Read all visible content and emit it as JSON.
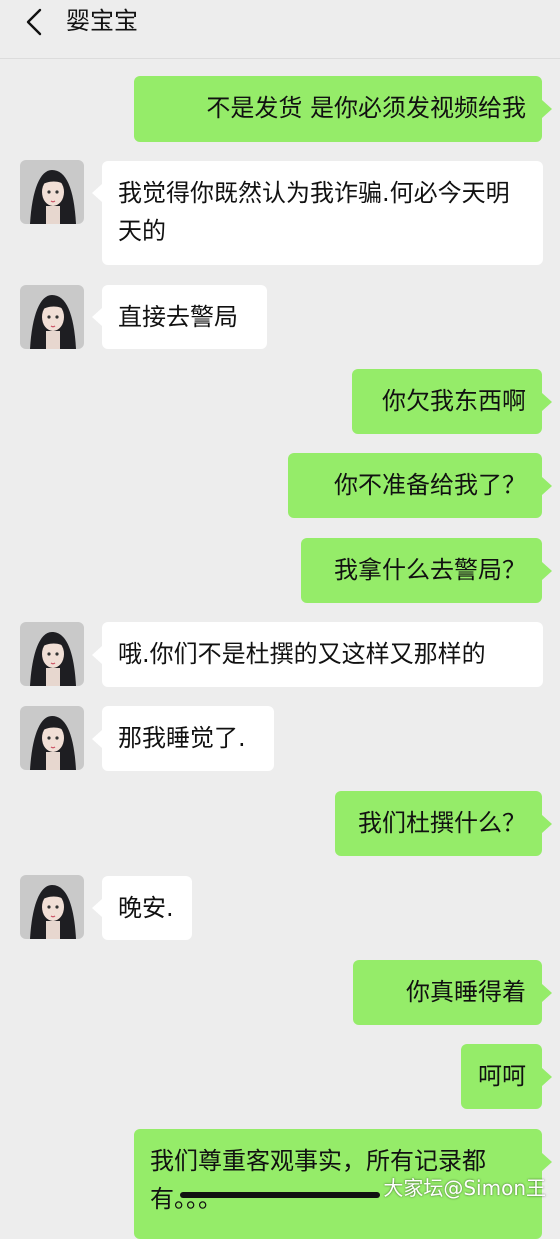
{
  "header": {
    "back_icon": "chevron-left-icon",
    "title": "婴宝宝"
  },
  "messages": [
    {
      "side": "sent",
      "text": "不是发货 是你必须发视频给我"
    },
    {
      "side": "recv",
      "text": "我觉得你既然认为我诈骗.何必今天明天的"
    },
    {
      "side": "recv",
      "text": "直接去警局"
    },
    {
      "side": "sent",
      "text": "你欠我东西啊"
    },
    {
      "side": "sent",
      "text": "你不准备给我了？"
    },
    {
      "side": "sent",
      "text": "我拿什么去警局？"
    },
    {
      "side": "recv",
      "text": "哦.你们不是杜撰的又这样又那样的"
    },
    {
      "side": "recv",
      "text": "那我睡觉了."
    },
    {
      "side": "sent",
      "text": "我们杜撰什么？"
    },
    {
      "side": "recv",
      "text": "晚安."
    },
    {
      "side": "sent",
      "text": "你真睡得着"
    },
    {
      "side": "sent",
      "text": "呵呵"
    },
    {
      "side": "sent",
      "text": "我们尊重客观事实，所有记录都有。。。"
    }
  ],
  "watermark": "大家坛@Simon王",
  "colors": {
    "background": "#ededed",
    "sent_bubble": "#95ec69",
    "received_bubble": "#ffffff"
  }
}
